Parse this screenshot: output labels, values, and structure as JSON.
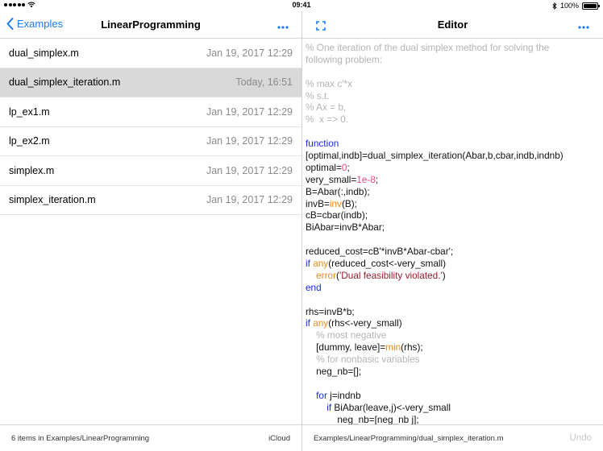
{
  "status": {
    "time": "09:41",
    "battery": "100%"
  },
  "left": {
    "back_label": "Examples",
    "title": "LinearProgramming",
    "files": [
      {
        "name": "dual_simplex.m",
        "date": "Jan 19, 2017 12:29",
        "selected": false
      },
      {
        "name": "dual_simplex_iteration.m",
        "date": "Today, 16:51",
        "selected": true
      },
      {
        "name": "lp_ex1.m",
        "date": "Jan 19, 2017 12:29",
        "selected": false
      },
      {
        "name": "lp_ex2.m",
        "date": "Jan 19, 2017 12:29",
        "selected": false
      },
      {
        "name": "simplex.m",
        "date": "Jan 19, 2017 12:29",
        "selected": false
      },
      {
        "name": "simplex_iteration.m",
        "date": "Jan 19, 2017 12:29",
        "selected": false
      }
    ],
    "footer_count": "6 items in Examples/LinearProgramming",
    "footer_location": "iCloud"
  },
  "right": {
    "title": "Editor",
    "footer_path": "Examples/LinearProgramming/dual_simplex_iteration.m",
    "undo_label": "Undo",
    "code_lines": [
      [
        [
          "comment",
          "% One iteration of the dual simplex method for solving the"
        ]
      ],
      [
        [
          "comment",
          "following problem:"
        ]
      ],
      [],
      [
        [
          "comment",
          "% max c'*x"
        ]
      ],
      [
        [
          "comment",
          "% s.t."
        ]
      ],
      [
        [
          "comment",
          "% Ax = b,"
        ]
      ],
      [
        [
          "comment",
          "%  x => 0."
        ]
      ],
      [],
      [
        [
          "keyword",
          "function"
        ]
      ],
      [
        [
          "plain",
          "[optimal,indb]=dual_simplex_iteration(Abar,b,cbar,indb,indnb)"
        ]
      ],
      [
        [
          "plain",
          "optimal="
        ],
        [
          "number",
          "0"
        ],
        [
          "plain",
          ";"
        ]
      ],
      [
        [
          "plain",
          "very_small="
        ],
        [
          "number",
          "1e-8"
        ],
        [
          "plain",
          ";"
        ]
      ],
      [
        [
          "plain",
          "B=Abar(:,indb);"
        ]
      ],
      [
        [
          "plain",
          "invB="
        ],
        [
          "builtin",
          "inv"
        ],
        [
          "plain",
          "(B);"
        ]
      ],
      [
        [
          "plain",
          "cB=cbar(indb);"
        ]
      ],
      [
        [
          "plain",
          "BiAbar=invB*Abar;"
        ]
      ],
      [],
      [
        [
          "plain",
          "reduced_cost=cB'*invB*Abar-cbar';"
        ]
      ],
      [
        [
          "keyword",
          "if "
        ],
        [
          "builtin",
          "any"
        ],
        [
          "plain",
          "(reduced_cost<-very_small)"
        ]
      ],
      [
        [
          "plain",
          "    "
        ],
        [
          "builtin",
          "error"
        ],
        [
          "plain",
          "("
        ],
        [
          "string",
          "'Dual feasibility violated.'"
        ],
        [
          "plain",
          ")"
        ]
      ],
      [
        [
          "keyword",
          "end"
        ]
      ],
      [],
      [
        [
          "plain",
          "rhs=invB*b;"
        ]
      ],
      [
        [
          "keyword",
          "if "
        ],
        [
          "builtin",
          "any"
        ],
        [
          "plain",
          "(rhs<-very_small)"
        ]
      ],
      [
        [
          "comment",
          "    % most negative"
        ]
      ],
      [
        [
          "plain",
          "    [dummy, leave]="
        ],
        [
          "builtin",
          "min"
        ],
        [
          "plain",
          "(rhs);"
        ]
      ],
      [
        [
          "comment",
          "    % for nonbasic variables"
        ]
      ],
      [
        [
          "plain",
          "    neg_nb=[];"
        ]
      ],
      [],
      [
        [
          "keyword",
          "    for "
        ],
        [
          "plain",
          "j=indnb"
        ]
      ],
      [
        [
          "keyword",
          "        if "
        ],
        [
          "plain",
          "BiAbar(leave,j)<-very_small"
        ]
      ],
      [
        [
          "plain",
          "            neg_nb=[neg_nb j];"
        ]
      ]
    ]
  },
  "colors": {
    "accent": "#1a7cf5",
    "comment": "#b4b4b4",
    "keyword": "#1b2ddb",
    "builtin": "#e58a1d",
    "number": "#e44a8a",
    "string": "#9a1e2e",
    "selected_row": "#d9d9d9"
  },
  "icons": {
    "back": "chevron-left-icon",
    "more": "ellipsis-icon",
    "expand": "expand-icon",
    "wifi": "wifi-icon",
    "bluetooth": "bluetooth-icon",
    "signal": "signal-dots-icon",
    "battery": "battery-icon"
  }
}
